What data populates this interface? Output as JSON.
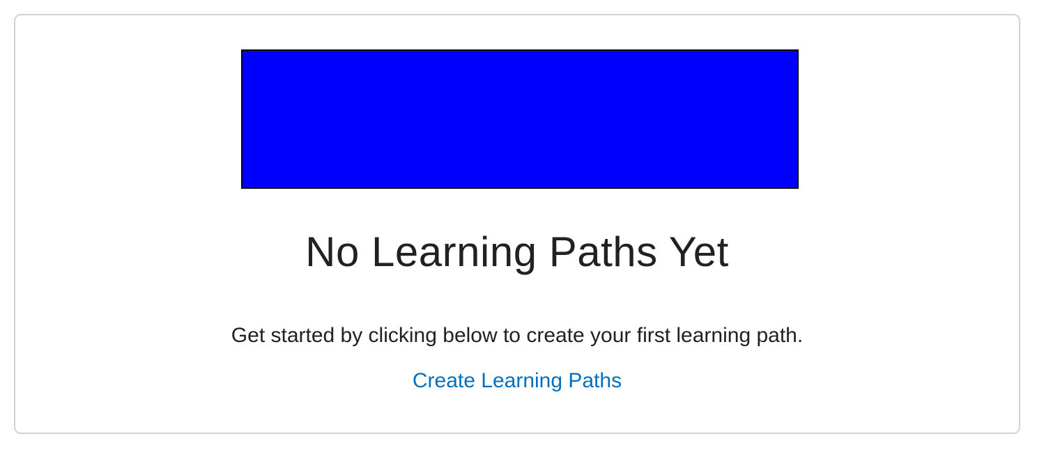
{
  "empty_state": {
    "title": "No Learning Paths Yet",
    "description": "Get started by clicking below to create your first learning path.",
    "action_label": "Create Learning Paths",
    "illustration_color": "#0000ff",
    "link_color": "#006fbf",
    "text_color": "#202122",
    "border_color": "#cdd3d8"
  }
}
